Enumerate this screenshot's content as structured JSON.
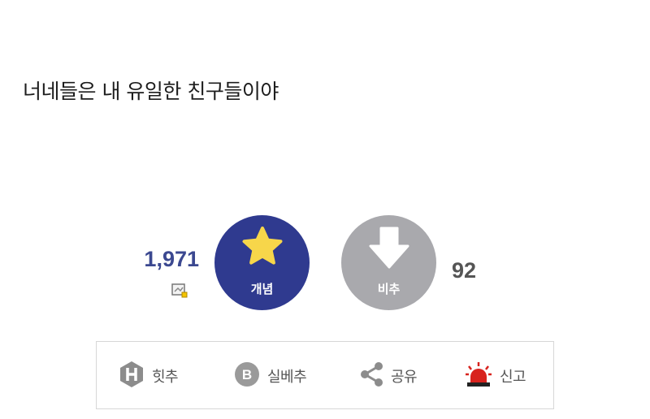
{
  "post": {
    "body_text": "너네들은 내 유일한 친구들이야"
  },
  "recommend": {
    "up_count": "1,971",
    "up_label": "개념",
    "down_label": "비추",
    "down_count": "92",
    "up_color": "#2f3a8f",
    "down_color": "#a9a9ad",
    "star_color": "#f7d64a"
  },
  "actions": {
    "hit_label": "힛추",
    "best_label": "실베추",
    "share_label": "공유",
    "report_label": "신고"
  },
  "icons": {
    "fix": "pin-note-icon",
    "hit": "hexagon-h-icon",
    "best": "circle-b-icon",
    "share": "share-icon",
    "report": "siren-icon"
  }
}
